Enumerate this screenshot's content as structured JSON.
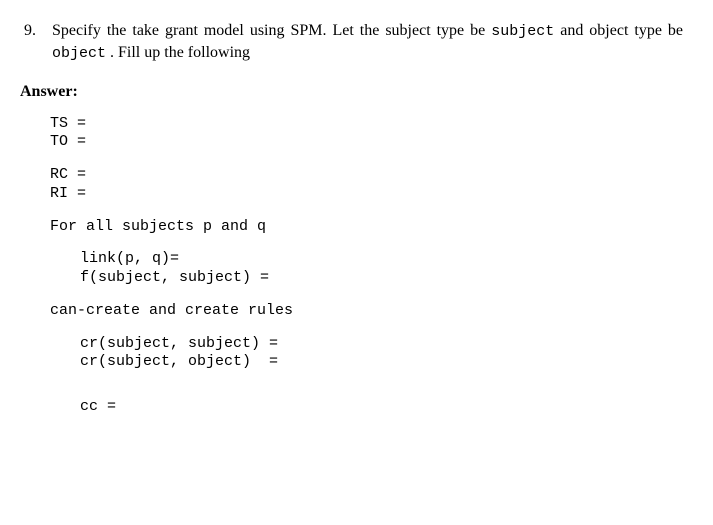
{
  "question": {
    "number": "9.",
    "seg1": "Specify the take grant model using SPM. Let the subject type be ",
    "code1": "subject",
    "seg2": " and object type be ",
    "code2": " object",
    "seg3": " . Fill up the following"
  },
  "answer_label": "Answer:",
  "code": {
    "l1": "TS =",
    "l2": "TO =",
    "l3": "RC =",
    "l4": "RI =",
    "l5": "For all subjects p and q",
    "l6": "link(p, q)=",
    "l7": "f(subject, subject) =",
    "l8": "can-create and create rules",
    "l9": "cr(subject, subject) =",
    "l10": "cr(subject, object)  =",
    "l11": "cc ="
  }
}
